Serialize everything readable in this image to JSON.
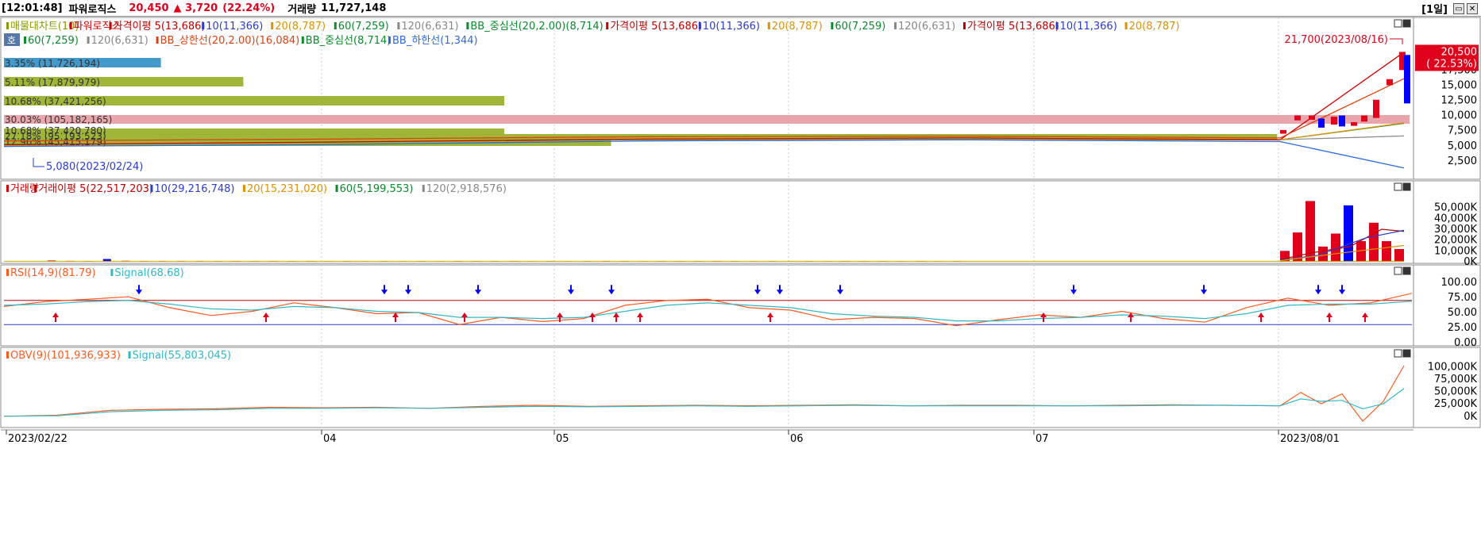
{
  "header": {
    "time": "[12:01:48]",
    "name": "파워로직스",
    "price": "20,450",
    "change": "▲ 3,720",
    "change_pct": "(22.24%)",
    "volume_label": "거래량",
    "volume": "11,727,148",
    "period": "[1일]",
    "colors": {
      "up": "#e0001b",
      "down": "#0000ff"
    }
  },
  "price_panel": {
    "legend_row1": [
      {
        "text": "매물대차트(10)",
        "color": "#8a9a00"
      },
      {
        "text": "파워로직스",
        "color": "#d00000"
      },
      {
        "text": "가격이평 5(13,686)",
        "color": "#c00000"
      },
      {
        "text": "10(11,366)",
        "color": "#2a3ccf"
      },
      {
        "text": "20(8,787)",
        "color": "#e09000"
      },
      {
        "text": "60(7,259)",
        "color": "#0a8a2a"
      },
      {
        "text": "120(6,631)",
        "color": "#888888"
      },
      {
        "text": "BB_중심선(20,2.00)(8,714)",
        "color": "#0a8a2a"
      },
      {
        "text": "가격이평 5(13,686)",
        "color": "#c00000"
      },
      {
        "text": "10(11,366)",
        "color": "#2a3ccf"
      },
      {
        "text": "20(8,787)",
        "color": "#e09000"
      },
      {
        "text": "60(7,259)",
        "color": "#0a8a2a"
      },
      {
        "text": "120(6,631)",
        "color": "#888888"
      },
      {
        "text": "가격이평 5(13,686)",
        "color": "#c00000"
      },
      {
        "text": "10(11,366)",
        "color": "#2a3ccf"
      },
      {
        "text": "20(8,787)",
        "color": "#e09000"
      }
    ],
    "legend_row2": [
      {
        "text": "60(7,259)",
        "color": "#0a8a2a"
      },
      {
        "text": "120(6,631)",
        "color": "#888888"
      },
      {
        "text": "BB_상한선(20,2.00)(16,084)",
        "color": "#e04010"
      },
      {
        "text": "BB_중심선(8,714)",
        "color": "#0a8a2a"
      },
      {
        "text": "BB_하한선(1,344)",
        "color": "#2a6ae0"
      }
    ],
    "y_ticks": [
      "20,500",
      "17,500",
      "15,000",
      "12,500",
      "10,000",
      "7,500",
      "5,000",
      "2,500"
    ],
    "price_tag": {
      "value": "20,500",
      "pct": "( 22.53%)"
    },
    "annotation_high": "21,700(2023/08/16)",
    "annotation_low": "5,080(2023/02/24)"
  },
  "chart_data": [
    {
      "type": "bar",
      "title": "매물대차트(10)",
      "categories": [
        "3.35% (11,726,194)",
        "5.11% (17,879,979)",
        "10.68% (37,421,256)",
        "30.03% (105,182,165)",
        "10.68% (37,420,780)",
        "27.18% (95,193,523)",
        "12.96% (45,415,179)"
      ],
      "values": [
        3.35,
        5.11,
        10.68,
        30.03,
        10.68,
        27.18,
        12.96
      ]
    },
    {
      "type": "line",
      "title": "파워로직스",
      "x": [
        "2023/02/22",
        "04",
        "05",
        "06",
        "07",
        "2023/08/01"
      ],
      "series": [
        {
          "name": "파워로직스",
          "values": [
            5200,
            5600,
            6100,
            6300,
            6000,
            20450
          ]
        },
        {
          "name": "BB_상한선(20,2.00)(16,084)",
          "values": [
            5800,
            6100,
            6500,
            6600,
            6300,
            16084
          ]
        },
        {
          "name": "BB_하한선(1,344)",
          "values": [
            4900,
            5200,
            5800,
            6000,
            5700,
            1344
          ]
        }
      ],
      "ylim": [
        0,
        22000
      ]
    },
    {
      "type": "bar",
      "title": "거래량",
      "y_ticks": [
        "50,000K",
        "40,000K",
        "30,000K",
        "20,000K",
        "10,000K",
        "0K"
      ],
      "legend": [
        {
          "text": "거래량",
          "color": "#d00000"
        },
        {
          "text": "거래이평 5(22,517,203)",
          "color": "#c00000"
        },
        {
          "text": "10(29,216,748)",
          "color": "#2a3ccf"
        },
        {
          "text": "20(15,231,020)",
          "color": "#e09000"
        },
        {
          "text": "60(5,199,553)",
          "color": "#0a8a2a"
        },
        {
          "text": "120(2,918,576)",
          "color": "#888888"
        }
      ],
      "values": [
        1200,
        800,
        500,
        2500,
        900,
        400,
        700,
        600,
        400,
        300,
        400,
        300,
        500,
        300,
        300,
        200,
        300,
        200,
        300,
        200,
        300,
        200,
        500,
        300,
        400,
        300,
        200,
        300,
        200,
        300,
        400,
        300,
        200,
        300,
        200,
        300,
        400,
        300,
        200,
        300,
        200,
        300,
        200,
        300,
        200,
        300,
        200,
        300,
        200,
        300,
        10000,
        27000,
        56000,
        14000,
        26000,
        52000,
        19000,
        36000,
        19000,
        11700
      ],
      "ylim": [
        0,
        60000
      ]
    },
    {
      "type": "line",
      "title": "RSI(14,9)(81.79)",
      "y_ticks": [
        "100.00",
        "75.00",
        "50.00",
        "25.00",
        "0.00"
      ],
      "series": [
        {
          "name": "RSI(14,9)(81.79)",
          "values": [
            60,
            68,
            72,
            76,
            58,
            45,
            52,
            66,
            58,
            48,
            50,
            30,
            42,
            35,
            40,
            62,
            70,
            72,
            58,
            54,
            38,
            42,
            40,
            28,
            38,
            46,
            42,
            52,
            40,
            34,
            58,
            74,
            62,
            66,
            81.79
          ]
        },
        {
          "name": "Signal(68.68)",
          "values": [
            62,
            64,
            68,
            70,
            64,
            56,
            54,
            60,
            58,
            52,
            50,
            42,
            42,
            40,
            42,
            52,
            62,
            66,
            62,
            58,
            48,
            44,
            42,
            36,
            36,
            40,
            42,
            46,
            44,
            40,
            48,
            62,
            64,
            64,
            68.68
          ]
        }
      ],
      "ylim": [
        0,
        100
      ]
    },
    {
      "type": "line",
      "title": "OBV(9)(101,936,933)",
      "y_ticks": [
        "100,000K",
        "75,000K",
        "50,000K",
        "25,000K",
        "0K"
      ],
      "series": [
        {
          "name": "OBV(9)(101,936,933)",
          "values": [
            0,
            2000,
            12000,
            14000,
            15000,
            18000,
            17000,
            18000,
            16000,
            20000,
            22000,
            20000,
            21000,
            22000,
            21000,
            22000,
            23000,
            21000,
            22000,
            22000,
            21000,
            22000,
            23000,
            22000,
            21000,
            48000,
            25000,
            45000,
            -10000,
            30000,
            101937
          ]
        },
        {
          "name": "Signal(55,803,045)",
          "values": [
            0,
            1000,
            9000,
            12000,
            13000,
            16000,
            16000,
            17000,
            16000,
            18000,
            20000,
            19000,
            20000,
            21000,
            20000,
            21000,
            22000,
            21000,
            21000,
            21000,
            21000,
            21000,
            22000,
            22000,
            21000,
            35000,
            30000,
            32000,
            15000,
            25000,
            55803
          ]
        }
      ],
      "ylim": [
        -10000,
        110000
      ]
    }
  ],
  "volume_panel": {
    "legend": [
      {
        "text": "거래량",
        "color": "#d00000"
      },
      {
        "text": "거래이평 5(22,517,203)",
        "color": "#c00000"
      },
      {
        "text": "10(29,216,748)",
        "color": "#2a3ccf"
      },
      {
        "text": "20(15,231,020)",
        "color": "#e09000"
      },
      {
        "text": "60(5,199,553)",
        "color": "#0a8a2a"
      },
      {
        "text": "120(2,918,576)",
        "color": "#888888"
      }
    ],
    "y_ticks": [
      "50,000K",
      "40,000K",
      "30,000K",
      "20,000K",
      "10,000K",
      "0K"
    ]
  },
  "rsi_panel": {
    "legend": [
      {
        "text": "RSI(14,9)(81.79)",
        "color": "#ff5a1e"
      },
      {
        "text": "Signal(68.68)",
        "color": "#30b8c8"
      }
    ],
    "y_ticks": [
      "100.00",
      "75.00",
      "50.00",
      "25.00",
      "0.00"
    ]
  },
  "obv_panel": {
    "legend": [
      {
        "text": "OBV(9)(101,936,933)",
        "color": "#ff5a1e"
      },
      {
        "text": "Signal(55,803,045)",
        "color": "#30b8c8"
      }
    ],
    "y_ticks": [
      "100,000K",
      "75,000K",
      "50,000K",
      "25,000K",
      "0K"
    ]
  },
  "x_axis": [
    "2023/02/22",
    "04",
    "05",
    "06",
    "07",
    "2023/08/01"
  ]
}
